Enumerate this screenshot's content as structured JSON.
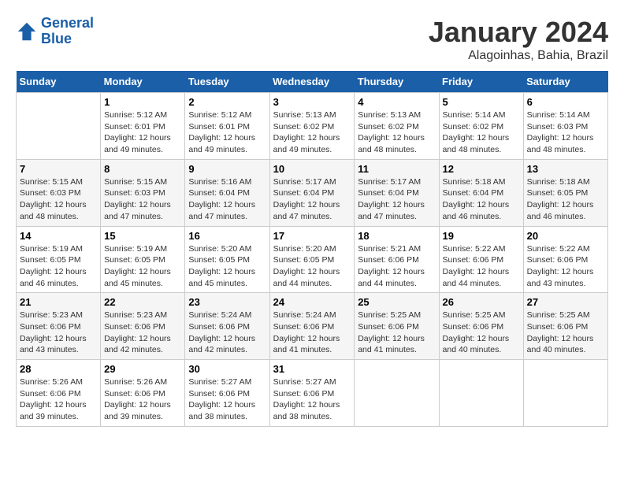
{
  "logo": {
    "line1": "General",
    "line2": "Blue"
  },
  "title": "January 2024",
  "subtitle": "Alagoinhas, Bahia, Brazil",
  "days_of_week": [
    "Sunday",
    "Monday",
    "Tuesday",
    "Wednesday",
    "Thursday",
    "Friday",
    "Saturday"
  ],
  "weeks": [
    [
      {
        "day": "",
        "info": ""
      },
      {
        "day": "1",
        "info": "Sunrise: 5:12 AM\nSunset: 6:01 PM\nDaylight: 12 hours\nand 49 minutes."
      },
      {
        "day": "2",
        "info": "Sunrise: 5:12 AM\nSunset: 6:01 PM\nDaylight: 12 hours\nand 49 minutes."
      },
      {
        "day": "3",
        "info": "Sunrise: 5:13 AM\nSunset: 6:02 PM\nDaylight: 12 hours\nand 49 minutes."
      },
      {
        "day": "4",
        "info": "Sunrise: 5:13 AM\nSunset: 6:02 PM\nDaylight: 12 hours\nand 48 minutes."
      },
      {
        "day": "5",
        "info": "Sunrise: 5:14 AM\nSunset: 6:02 PM\nDaylight: 12 hours\nand 48 minutes."
      },
      {
        "day": "6",
        "info": "Sunrise: 5:14 AM\nSunset: 6:03 PM\nDaylight: 12 hours\nand 48 minutes."
      }
    ],
    [
      {
        "day": "7",
        "info": "Sunrise: 5:15 AM\nSunset: 6:03 PM\nDaylight: 12 hours\nand 48 minutes."
      },
      {
        "day": "8",
        "info": "Sunrise: 5:15 AM\nSunset: 6:03 PM\nDaylight: 12 hours\nand 47 minutes."
      },
      {
        "day": "9",
        "info": "Sunrise: 5:16 AM\nSunset: 6:04 PM\nDaylight: 12 hours\nand 47 minutes."
      },
      {
        "day": "10",
        "info": "Sunrise: 5:17 AM\nSunset: 6:04 PM\nDaylight: 12 hours\nand 47 minutes."
      },
      {
        "day": "11",
        "info": "Sunrise: 5:17 AM\nSunset: 6:04 PM\nDaylight: 12 hours\nand 47 minutes."
      },
      {
        "day": "12",
        "info": "Sunrise: 5:18 AM\nSunset: 6:04 PM\nDaylight: 12 hours\nand 46 minutes."
      },
      {
        "day": "13",
        "info": "Sunrise: 5:18 AM\nSunset: 6:05 PM\nDaylight: 12 hours\nand 46 minutes."
      }
    ],
    [
      {
        "day": "14",
        "info": "Sunrise: 5:19 AM\nSunset: 6:05 PM\nDaylight: 12 hours\nand 46 minutes."
      },
      {
        "day": "15",
        "info": "Sunrise: 5:19 AM\nSunset: 6:05 PM\nDaylight: 12 hours\nand 45 minutes."
      },
      {
        "day": "16",
        "info": "Sunrise: 5:20 AM\nSunset: 6:05 PM\nDaylight: 12 hours\nand 45 minutes."
      },
      {
        "day": "17",
        "info": "Sunrise: 5:20 AM\nSunset: 6:05 PM\nDaylight: 12 hours\nand 44 minutes."
      },
      {
        "day": "18",
        "info": "Sunrise: 5:21 AM\nSunset: 6:06 PM\nDaylight: 12 hours\nand 44 minutes."
      },
      {
        "day": "19",
        "info": "Sunrise: 5:22 AM\nSunset: 6:06 PM\nDaylight: 12 hours\nand 44 minutes."
      },
      {
        "day": "20",
        "info": "Sunrise: 5:22 AM\nSunset: 6:06 PM\nDaylight: 12 hours\nand 43 minutes."
      }
    ],
    [
      {
        "day": "21",
        "info": "Sunrise: 5:23 AM\nSunset: 6:06 PM\nDaylight: 12 hours\nand 43 minutes."
      },
      {
        "day": "22",
        "info": "Sunrise: 5:23 AM\nSunset: 6:06 PM\nDaylight: 12 hours\nand 42 minutes."
      },
      {
        "day": "23",
        "info": "Sunrise: 5:24 AM\nSunset: 6:06 PM\nDaylight: 12 hours\nand 42 minutes."
      },
      {
        "day": "24",
        "info": "Sunrise: 5:24 AM\nSunset: 6:06 PM\nDaylight: 12 hours\nand 41 minutes."
      },
      {
        "day": "25",
        "info": "Sunrise: 5:25 AM\nSunset: 6:06 PM\nDaylight: 12 hours\nand 41 minutes."
      },
      {
        "day": "26",
        "info": "Sunrise: 5:25 AM\nSunset: 6:06 PM\nDaylight: 12 hours\nand 40 minutes."
      },
      {
        "day": "27",
        "info": "Sunrise: 5:25 AM\nSunset: 6:06 PM\nDaylight: 12 hours\nand 40 minutes."
      }
    ],
    [
      {
        "day": "28",
        "info": "Sunrise: 5:26 AM\nSunset: 6:06 PM\nDaylight: 12 hours\nand 39 minutes."
      },
      {
        "day": "29",
        "info": "Sunrise: 5:26 AM\nSunset: 6:06 PM\nDaylight: 12 hours\nand 39 minutes."
      },
      {
        "day": "30",
        "info": "Sunrise: 5:27 AM\nSunset: 6:06 PM\nDaylight: 12 hours\nand 38 minutes."
      },
      {
        "day": "31",
        "info": "Sunrise: 5:27 AM\nSunset: 6:06 PM\nDaylight: 12 hours\nand 38 minutes."
      },
      {
        "day": "",
        "info": ""
      },
      {
        "day": "",
        "info": ""
      },
      {
        "day": "",
        "info": ""
      }
    ]
  ]
}
